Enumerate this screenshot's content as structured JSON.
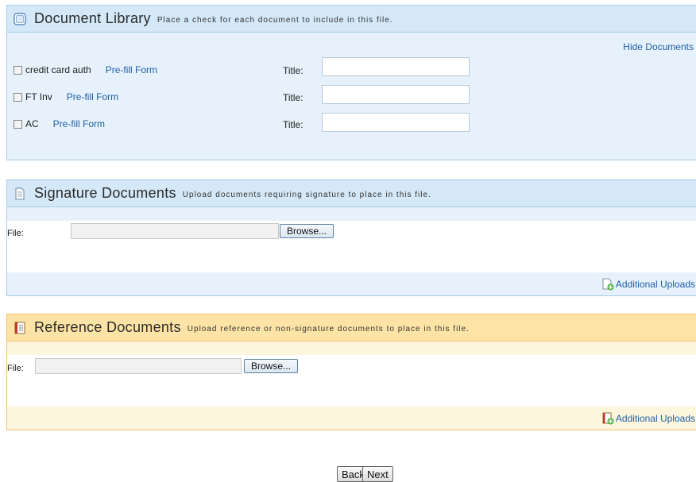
{
  "library": {
    "title": "Document Library",
    "subtitle": "Place a check for each document to include in this file.",
    "hide_link": "Hide Documents",
    "docs": [
      {
        "name": "credit card auth",
        "prefill": "Pre-fill Form",
        "title_label": "Title:",
        "title_value": ""
      },
      {
        "name": "FT Inv",
        "prefill": "Pre-fill Form",
        "title_label": "Title:",
        "title_value": ""
      },
      {
        "name": "AC",
        "prefill": "Pre-fill Form",
        "title_label": "Title:",
        "title_value": ""
      }
    ]
  },
  "signature": {
    "title": "Signature Documents",
    "subtitle": "Upload documents requiring signature to place in this file.",
    "file_label": "File:",
    "browse_label": "Browse...",
    "additional_label": "Additional Uploads"
  },
  "reference": {
    "title": "Reference Documents",
    "subtitle": "Upload reference or non-signature documents to place in this file.",
    "file_label": "File:",
    "browse_label": "Browse...",
    "additional_label": "Additional Uploads"
  },
  "nav": {
    "back_label": "Back",
    "next_label": "Next"
  }
}
